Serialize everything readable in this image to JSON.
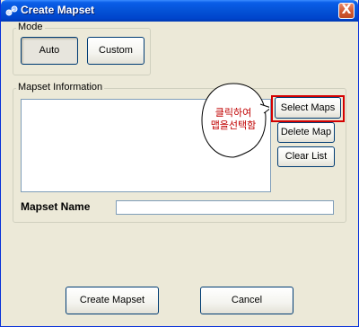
{
  "window": {
    "title": "Create Mapset",
    "close_glyph": "X"
  },
  "mode": {
    "label": "Mode",
    "auto_label": "Auto",
    "custom_label": "Custom",
    "selected": "Auto"
  },
  "mapset_info": {
    "label": "Mapset Information",
    "select_maps_label": "Select Maps",
    "delete_map_label": "Delete Map",
    "clear_list_label": "Clear List",
    "map_list": []
  },
  "callout": {
    "line1": "클릭하여",
    "line2": "맵을선택함",
    "color": "#c00000"
  },
  "mapset_name": {
    "label": "Mapset Name",
    "value": ""
  },
  "footer": {
    "create_label": "Create Mapset",
    "cancel_label": "Cancel"
  },
  "colors": {
    "titlebar": "#0452d6",
    "dialog_bg": "#ece9d8",
    "highlight_border": "#d40000"
  },
  "icons": [
    "app-icon",
    "close-icon",
    "speech-bubble"
  ]
}
